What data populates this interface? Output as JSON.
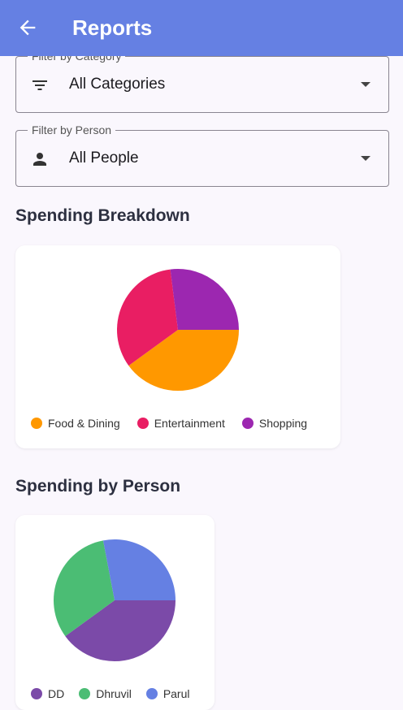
{
  "appbar": {
    "title": "Reports"
  },
  "filters": {
    "category": {
      "label": "Filter by Category",
      "value": "All Categories"
    },
    "person": {
      "label": "Filter by Person",
      "value": "All People"
    }
  },
  "sections": {
    "breakdown_title": "Spending Breakdown",
    "person_title": "Spending by Person"
  },
  "chart_data": [
    {
      "type": "pie",
      "title": "Spending Breakdown",
      "categories": [
        "Food & Dining",
        "Entertainment",
        "Shopping"
      ],
      "values": [
        40,
        33,
        27
      ],
      "colors": [
        "#ff9800",
        "#e91e63",
        "#9c27b0"
      ]
    },
    {
      "type": "pie",
      "title": "Spending by Person",
      "categories": [
        "DD",
        "Dhruvil",
        "Parul"
      ],
      "values": [
        40,
        32,
        28
      ],
      "colors": [
        "#7b4aa8",
        "#4bbd74",
        "#6580e3"
      ]
    }
  ]
}
